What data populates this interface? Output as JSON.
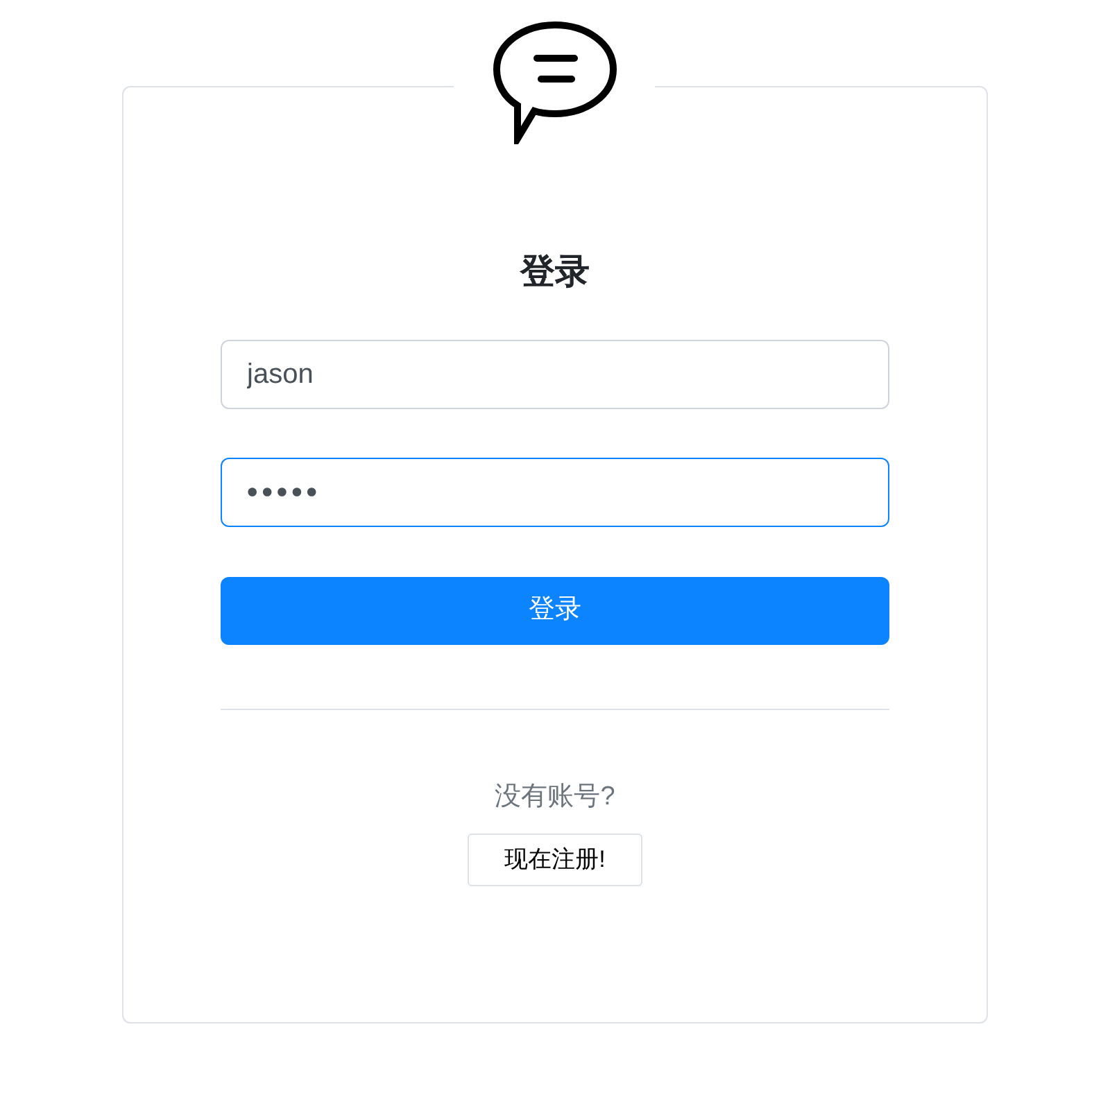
{
  "title": "登录",
  "fields": [
    {
      "kind": "text",
      "value": "jason",
      "focused": false
    },
    {
      "kind": "password",
      "value": "•••••",
      "focused": true
    }
  ],
  "submit": "登录",
  "prompt": "没有账号?",
  "register": "现在注册!"
}
